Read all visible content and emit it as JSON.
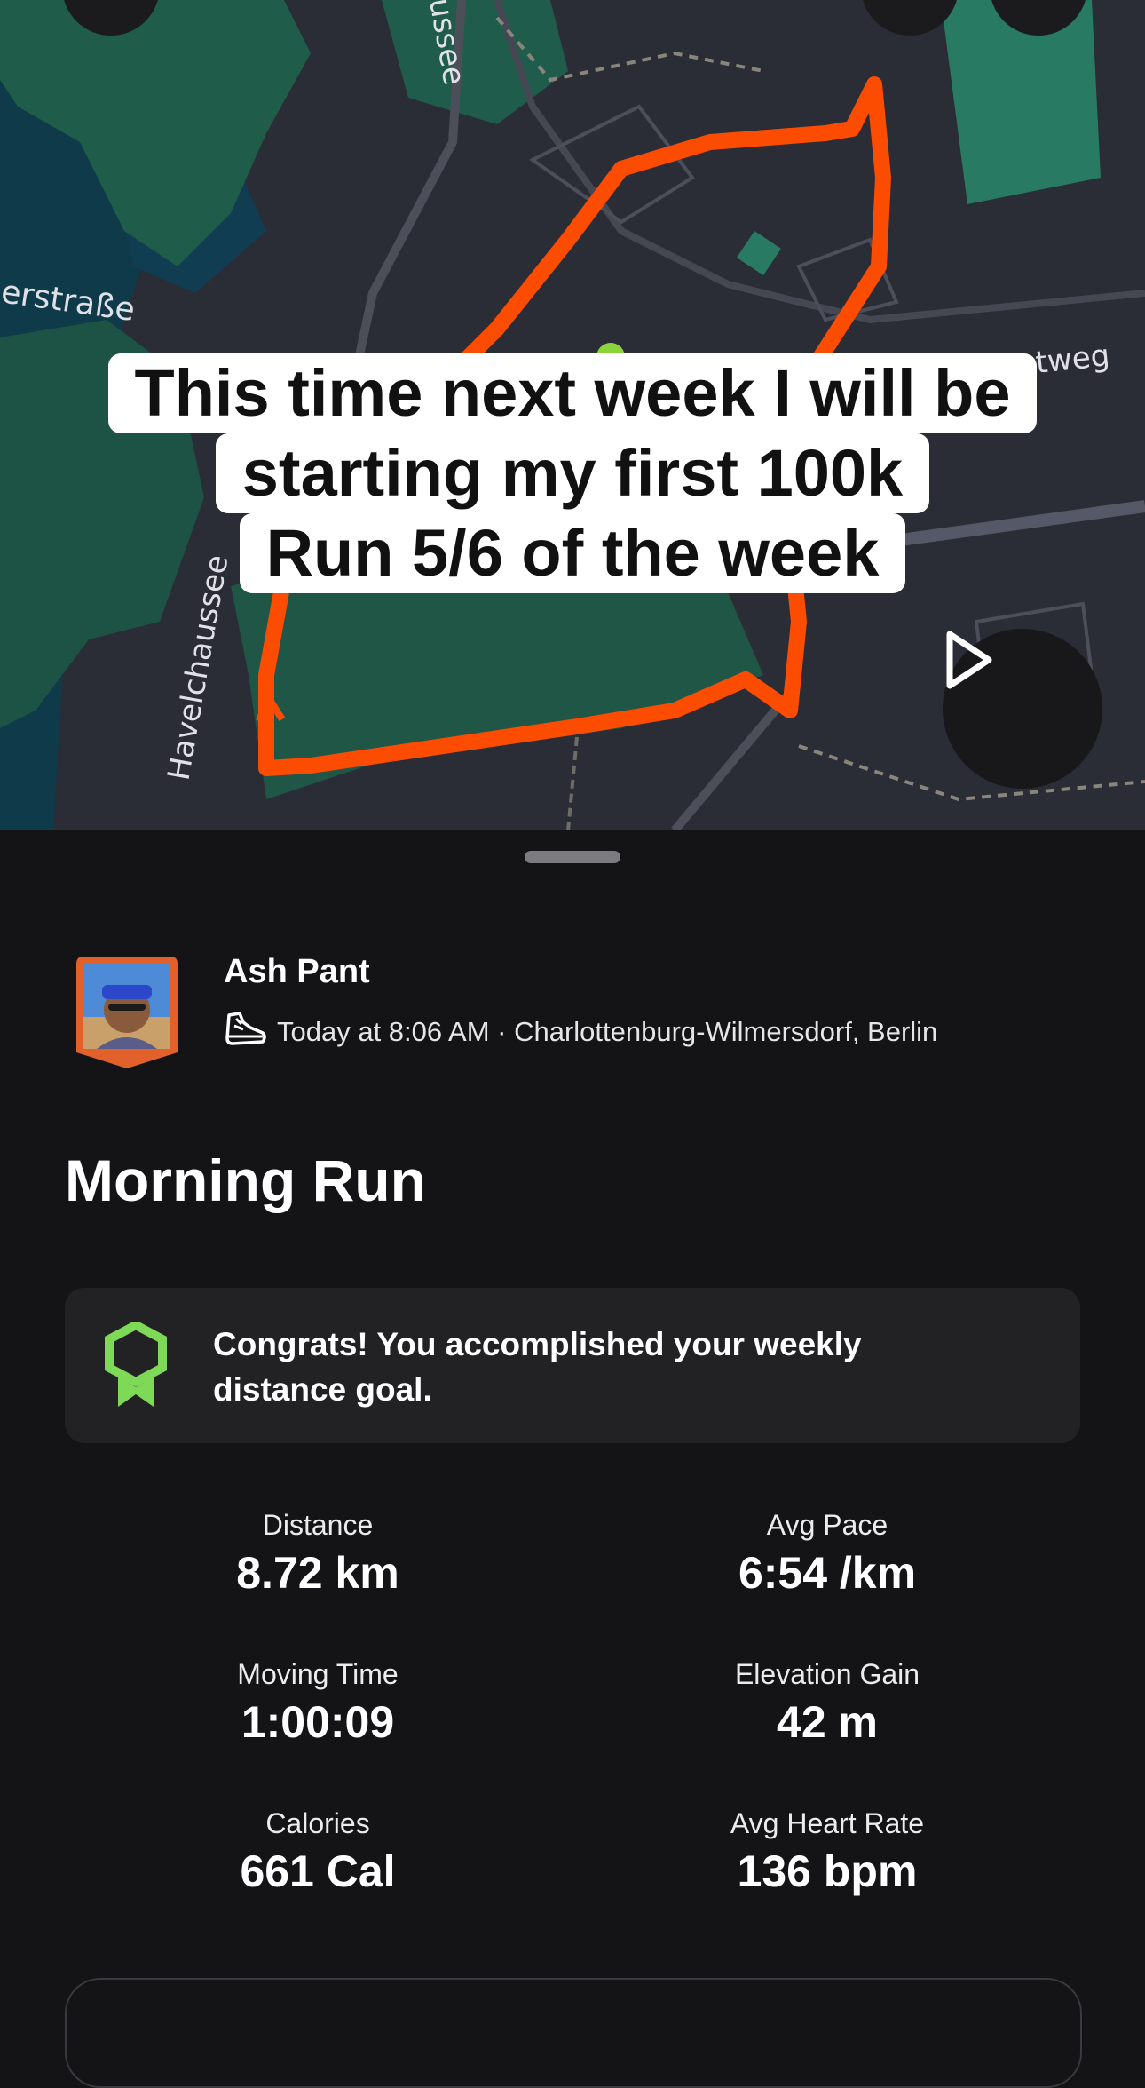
{
  "map": {
    "labels": {
      "street_top": "ussee",
      "street_left": "erstraße",
      "street_right": "tweg",
      "street_havel": "Havelchaussee"
    },
    "route_color": "#FC4C02"
  },
  "caption": {
    "line1": "This time next week I will be",
    "line2": "starting my first 100k",
    "line3": "Run 5/6 of the week"
  },
  "play_button": {
    "icon": "play-icon"
  },
  "athlete": {
    "name": "Ash Pant",
    "activity_icon": "shoe-icon",
    "meta": "Today at 8:06 AM · Charlottenburg-Wilmersdorf, Berlin"
  },
  "activity": {
    "title": "Morning Run"
  },
  "goal": {
    "icon": "award-ribbon-icon",
    "text": "Congrats! You accomplished your weekly distance goal.",
    "accent": "#7ED957"
  },
  "stats": [
    {
      "label": "Distance",
      "value": "8.72 km"
    },
    {
      "label": "Avg Pace",
      "value": "6:54 /km"
    },
    {
      "label": "Moving Time",
      "value": "1:00:09"
    },
    {
      "label": "Elevation Gain",
      "value": "42 m"
    },
    {
      "label": "Calories",
      "value": "661 Cal"
    },
    {
      "label": "Avg Heart Rate",
      "value": "136 bpm"
    }
  ]
}
